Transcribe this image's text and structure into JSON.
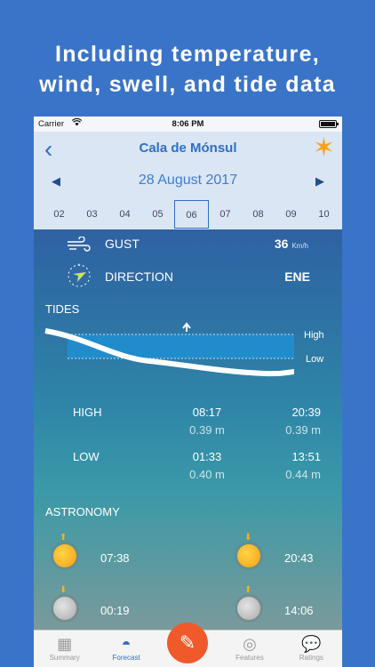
{
  "promo": {
    "line1": "Including temperature,",
    "line2": "wind, swell, and tide data"
  },
  "status": {
    "carrier": "Carrier",
    "time": "8:06 PM"
  },
  "nav": {
    "title": "Cala de Mónsul",
    "date": "28 August 2017",
    "days": [
      "02",
      "03",
      "04",
      "05",
      "06",
      "07",
      "08",
      "09",
      "10"
    ],
    "selected_day": "06"
  },
  "wind": {
    "gust_label": "GUST",
    "gust_value": "36",
    "gust_unit": "Km/h",
    "direction_label": "DIRECTION",
    "direction_value": "ENE"
  },
  "tides": {
    "title": "TIDES",
    "high_label": "High",
    "low_label": "Low",
    "rows": [
      {
        "label": "HIGH",
        "t1": "08:17",
        "h1": "0.39 m",
        "t2": "20:39",
        "h2": "0.39 m"
      },
      {
        "label": "LOW",
        "t1": "01:33",
        "h1": "0.40 m",
        "t2": "13:51",
        "h2": "0.44 m"
      }
    ]
  },
  "astronomy": {
    "title": "ASTRONOMY",
    "sunrise": "07:38",
    "sunset": "20:43",
    "moonset": "00:19",
    "moonrise": "14:06"
  },
  "tabs": {
    "summary": "Summary",
    "forecast": "Forecast",
    "features": "Features",
    "ratings": "Ratings"
  },
  "colors": {
    "background": "#3a74c9",
    "accent": "#2d6fc3",
    "star": "#f4a21b",
    "fab": "#f05a2a"
  }
}
